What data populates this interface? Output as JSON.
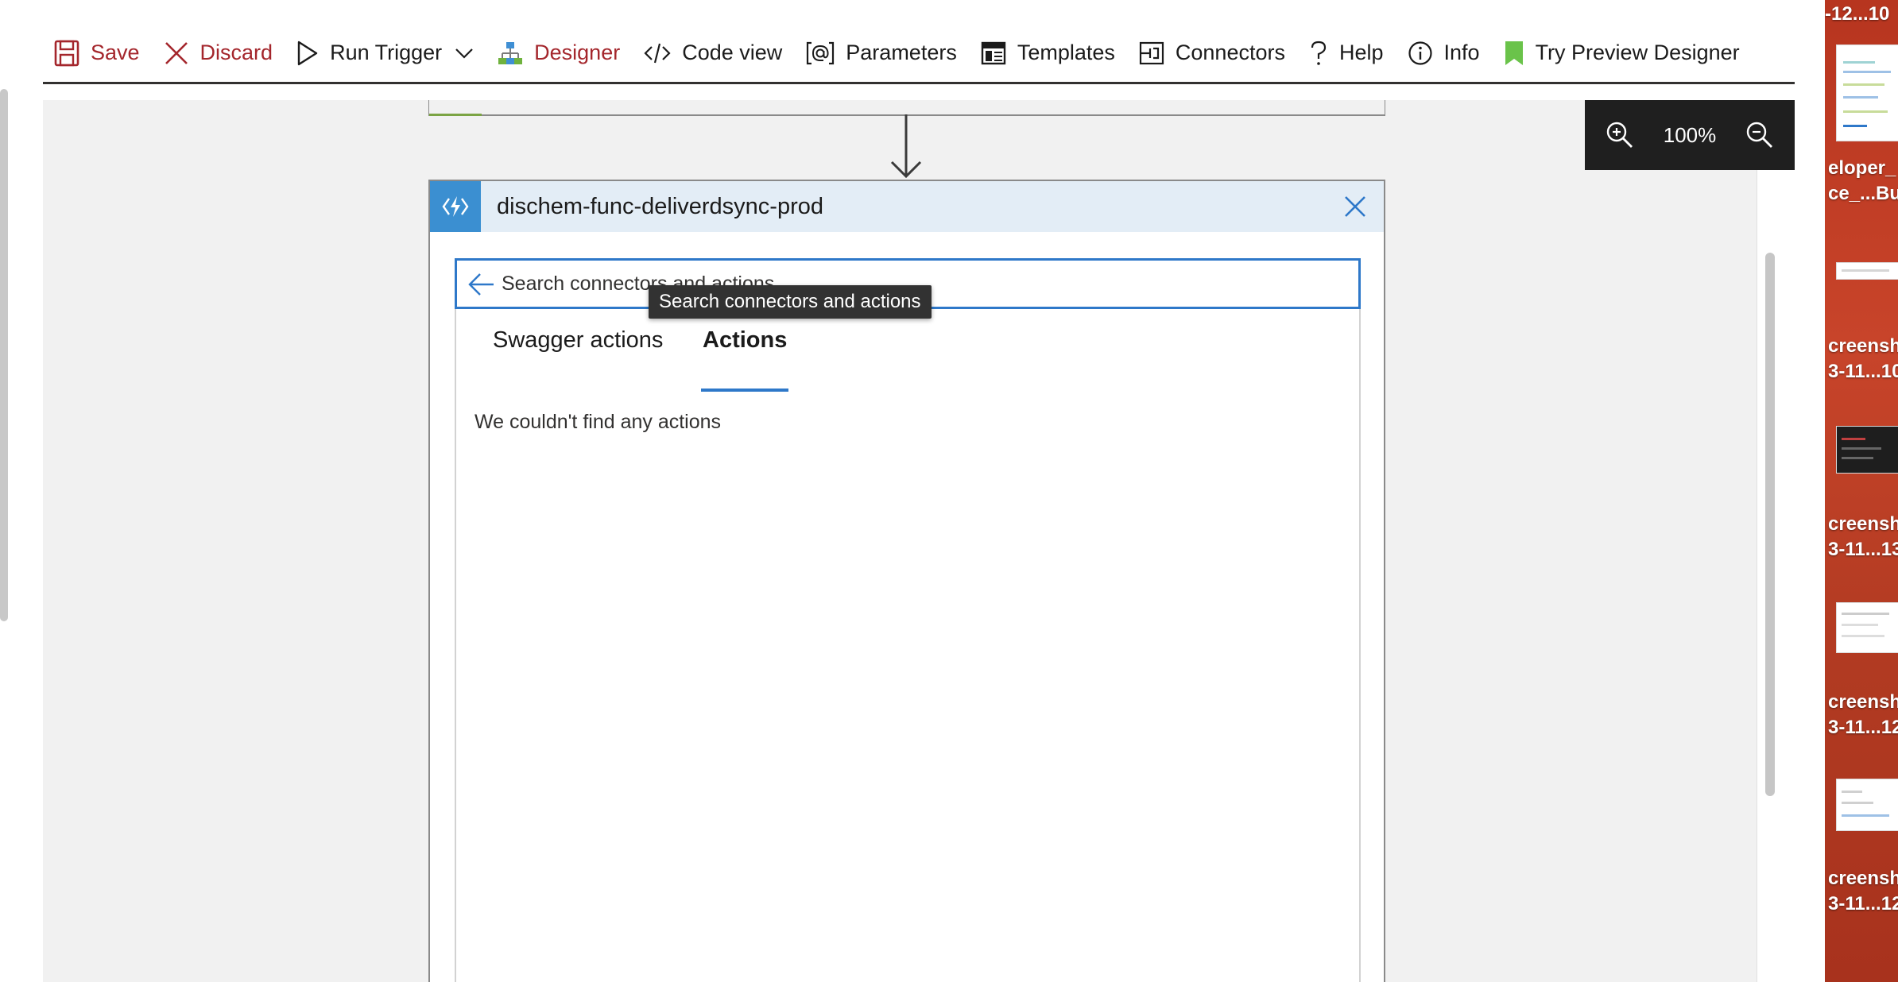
{
  "toolbar": {
    "save": "Save",
    "discard": "Discard",
    "run_trigger": "Run Trigger",
    "designer": "Designer",
    "code_view": "Code view",
    "parameters": "Parameters",
    "templates": "Templates",
    "connectors": "Connectors",
    "help": "Help",
    "info": "Info",
    "try_preview": "Try Preview Designer"
  },
  "zoom": {
    "level": "100%"
  },
  "card": {
    "title": "dischem-func-deliverdsync-prod",
    "search_placeholder": "Search connectors and actions",
    "tooltip": "Search connectors and actions",
    "tabs": [
      {
        "label": "Swagger actions",
        "active": false
      },
      {
        "label": "Actions",
        "active": true
      }
    ],
    "empty_message": "We couldn't find any actions"
  },
  "desktop_labels": [
    {
      "line1": "-12...10"
    },
    {
      "line1": "eloper_",
      "line2": "ce_...Bu"
    },
    {
      "line1": "creensh",
      "line2": "3-11...10"
    },
    {
      "line1": "creensh",
      "line2": "3-11...13"
    },
    {
      "line1": "creensh",
      "line2": "3-11...12"
    },
    {
      "line1": "creensh",
      "line2": "3-11...12"
    }
  ],
  "colors": {
    "accent_blue": "#2e78c9",
    "discard_red": "#a4262c",
    "card_header_bg": "#e3edf6",
    "function_icon_bg": "#3b8fd1",
    "canvas_bg": "#f1f1f1",
    "preview_bookmark": "#6ac34a"
  }
}
